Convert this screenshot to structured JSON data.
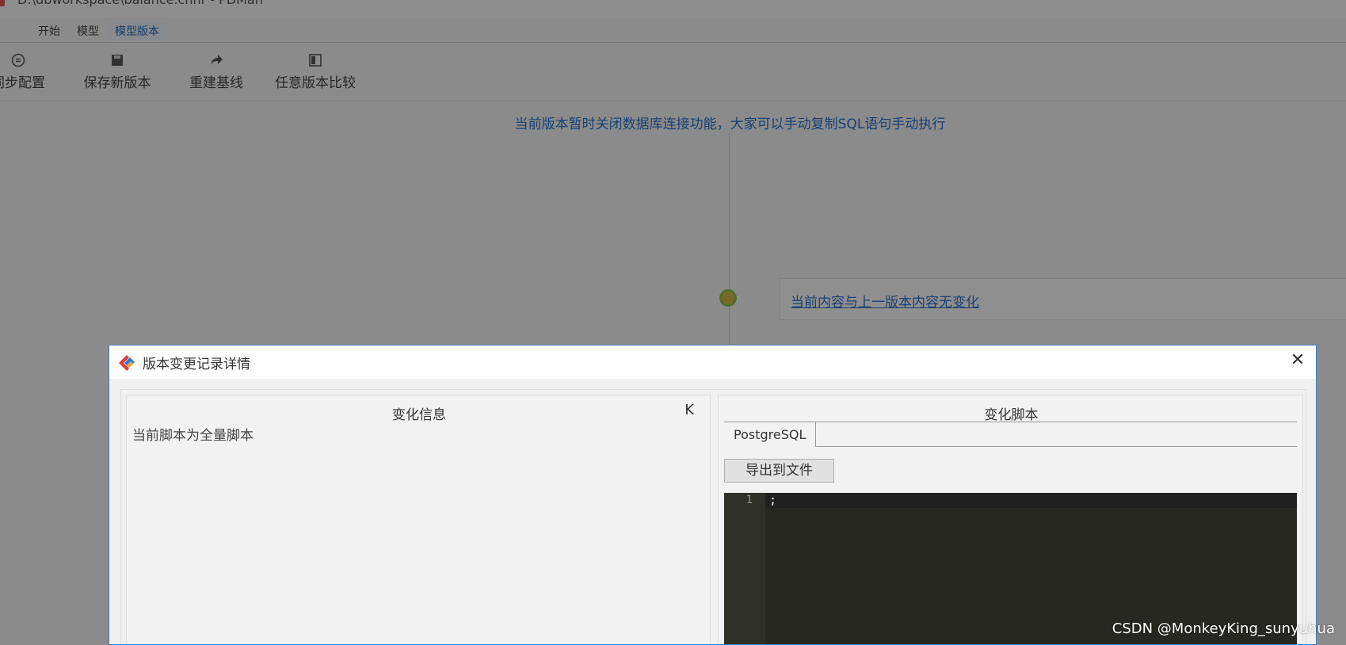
{
  "window": {
    "title": "D:\\dbworkspace\\balance.chnr - PDMan"
  },
  "menu": {
    "items": [
      {
        "label": "开始"
      },
      {
        "label": "模型"
      },
      {
        "label": "模型版本",
        "active": true
      }
    ]
  },
  "toolbar": {
    "items": [
      {
        "label": "同步配置",
        "icon": "sync-icon"
      },
      {
        "label": "保存新版本",
        "icon": "save-icon"
      },
      {
        "label": "重建基线",
        "icon": "share-arrow-icon"
      },
      {
        "label": "任意版本比较",
        "icon": "compare-icon"
      }
    ]
  },
  "main": {
    "notice": "当前版本暂时关闭数据库连接功能，大家可以手动复制SQL语句手动执行",
    "version_change_link": "当前内容与上一版本内容无变化"
  },
  "dialog": {
    "title": "版本变更记录详情",
    "close_icon": "close-icon",
    "left_panel": {
      "title": "变化信息",
      "collapse_icon": "K",
      "content": "当前脚本为全量脚本"
    },
    "right_panel": {
      "title": "变化脚本",
      "tabs": [
        {
          "label": "PostgreSQL"
        }
      ],
      "export_label": "导出到文件",
      "editor": {
        "line_numbers": [
          "1"
        ],
        "code": ";"
      }
    }
  },
  "watermark": "CSDN @MonkeyKing_sunyuhua",
  "colors": {
    "accent": "#2a6fc9",
    "editor_bg": "#272822",
    "dialog_border": "#3c7fc7"
  }
}
